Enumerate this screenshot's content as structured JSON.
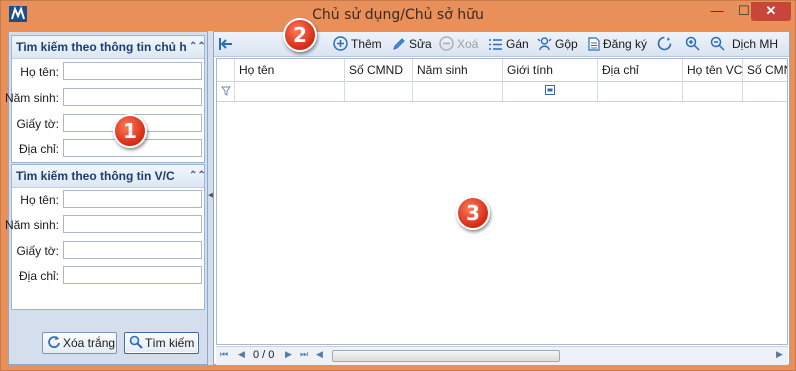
{
  "window": {
    "title": "Chủ sử dụng/Chủ sở hữu",
    "minimize": "—",
    "maximize": "☐",
    "close": "✕"
  },
  "left_panel": {
    "group1": {
      "header": "Tìm kiếm theo thông tin chủ h",
      "fields": [
        {
          "label": "Họ tên:",
          "value": ""
        },
        {
          "label": "Năm sinh:",
          "value": ""
        },
        {
          "label": "Giấy tờ:",
          "value": ""
        },
        {
          "label": "Địa chỉ:",
          "value": ""
        }
      ]
    },
    "group2": {
      "header": "Tìm kiếm theo thông tin V/C",
      "fields": [
        {
          "label": "Họ tên:",
          "value": ""
        },
        {
          "label": "Năm sinh:",
          "value": ""
        },
        {
          "label": "Giấy tờ:",
          "value": ""
        },
        {
          "label": "Địa chỉ:",
          "value": ""
        }
      ]
    },
    "clear_button": "Xóa trắng",
    "search_button": "Tìm kiếm"
  },
  "toolbar": {
    "add": "Thêm",
    "edit": "Sửa",
    "delete": "Xoá",
    "assign": "Gán",
    "merge": "Gộp",
    "register": "Đăng ký",
    "move": "Dịch MH"
  },
  "grid": {
    "columns": [
      "Họ tên",
      "Số CMND",
      "Năm sinh",
      "Giới tính",
      "Địa chỉ",
      "Họ tên VC",
      "Số CMND"
    ],
    "rows": []
  },
  "footer": {
    "page_info": "0 / 0"
  },
  "callouts": [
    "1",
    "2",
    "3"
  ],
  "colors": {
    "window_frame": "#e98f59",
    "close_button": "#c7463a",
    "panel_background": "#d4deed",
    "header_text": "#1c3f6e",
    "callout": "#d42a14"
  }
}
